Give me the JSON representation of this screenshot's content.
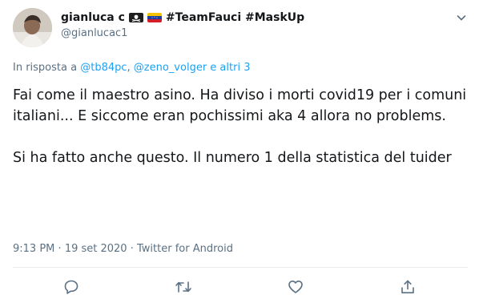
{
  "tweet": {
    "display_name": "gianluca c",
    "display_name_suffix": "#TeamFauci #MaskUp",
    "handle": "@gianlucac1",
    "reply": {
      "prefix": "In risposta a",
      "mention1": "@tb84pc",
      "separator": ",",
      "mention2": "@zeno_volger e altri 3"
    },
    "text_para1": "Fai come il maestro asino. Ha diviso i morti covid19 per i comuni italiani... E siccome eran pochissimi aka 4 allora no problems.",
    "text_para2": "Si ha fatto anche questo. Il numero 1 della statistica del tuider",
    "time": "9:13 PM",
    "date": "19 set 2020",
    "source": "Twitter for Android",
    "meta_separator": "·"
  },
  "icons": {
    "caret": "chevron-down-icon",
    "flag1": "pirate-flag-icon",
    "flag2": "venezuela-flag-icon",
    "reply": "reply-icon",
    "retweet": "retweet-icon",
    "like": "like-icon",
    "share": "share-icon"
  },
  "colors": {
    "link": "#1da1f2",
    "secondary_text": "#5b7083",
    "primary_text": "#14171a",
    "icon": "#5b7083"
  }
}
